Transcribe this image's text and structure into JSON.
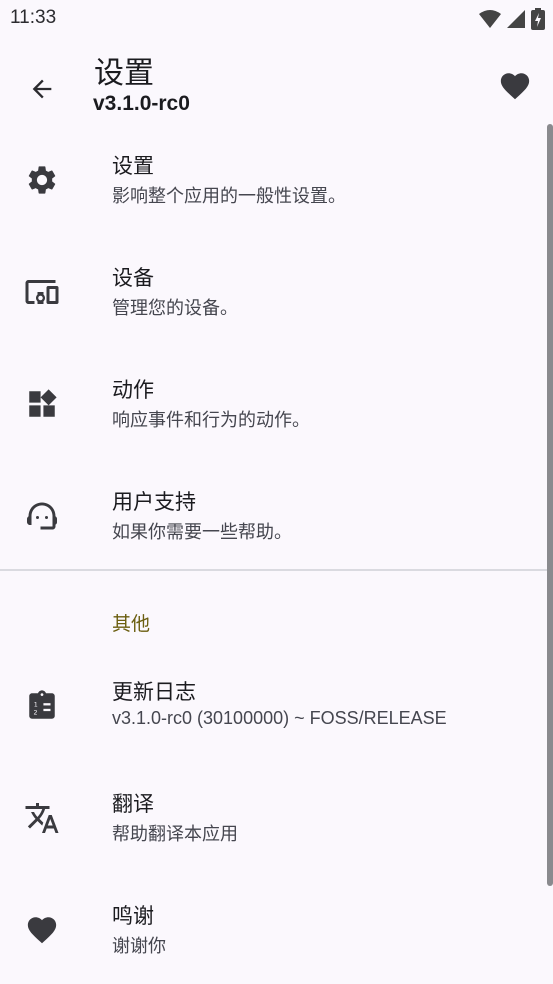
{
  "status_bar": {
    "time": "11:33"
  },
  "app_bar": {
    "title": "设置",
    "subtitle": "v3.1.0-rc0"
  },
  "items": [
    {
      "title": "设置",
      "subtitle": "影响整个应用的一般性设置。",
      "icon": "gear-icon"
    },
    {
      "title": "设备",
      "subtitle": "管理您的设备。",
      "icon": "devices-icon"
    },
    {
      "title": "动作",
      "subtitle": "响应事件和行为的动作。",
      "icon": "widgets-icon"
    },
    {
      "title": "用户支持",
      "subtitle": "如果你需要一些帮助。",
      "icon": "support-agent-icon"
    }
  ],
  "section": {
    "header": "其他"
  },
  "other_items": [
    {
      "title": "更新日志",
      "subtitle": "v3.1.0-rc0 (30100000) ~ FOSS/RELEASE",
      "icon": "changelog-icon"
    },
    {
      "title": "翻译",
      "subtitle": "帮助翻译本应用",
      "icon": "translate-icon"
    },
    {
      "title": "鸣谢",
      "subtitle": "谢谢你",
      "icon": "heart-icon"
    }
  ],
  "colors": {
    "background": "#fbf8fd",
    "section_header": "#6b5e10",
    "icon": "#3a3a3f"
  }
}
